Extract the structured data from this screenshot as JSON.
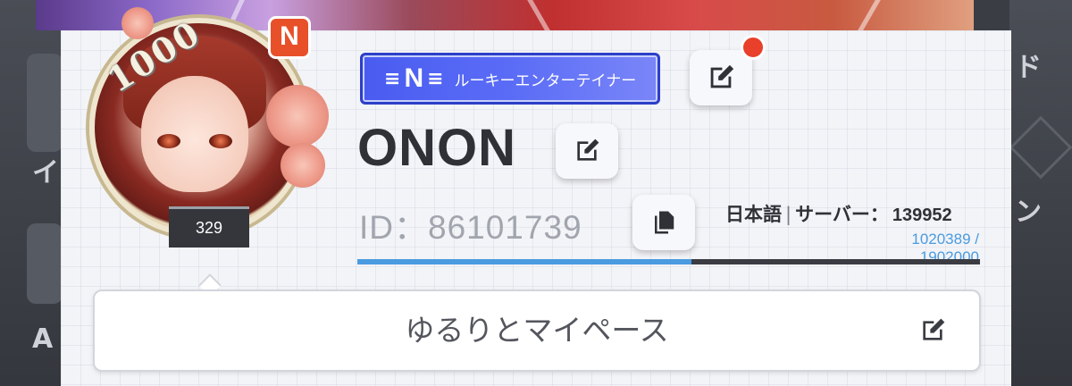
{
  "background": {
    "left_fragment_text": "イ",
    "left_fragment_text2": "A",
    "right_fragment_text": "ド",
    "right_fragment_text2": "ン"
  },
  "avatar": {
    "frame_number": "1000",
    "badge_letter": "N",
    "level": "329"
  },
  "title_badge": {
    "emblem_letter": "N",
    "label": "ルーキーエンターテイナー"
  },
  "player": {
    "name": "ONON",
    "id_label": "ID：86101739"
  },
  "info": {
    "language": "日本語",
    "separator": "|",
    "server_label": "サーバー：",
    "server_number": "139952"
  },
  "exp": {
    "current": 1020389,
    "max": 1902000,
    "text": "1020389 / 1902000"
  },
  "comment": {
    "text": "ゆるりとマイペース"
  },
  "icons": {
    "title_edit": "edit-icon",
    "name_edit": "edit-icon",
    "copy_id": "copy-icon",
    "comment_edit": "edit-icon"
  },
  "colors": {
    "title_blue": "#4a5cf0",
    "exp_blue": "#4a9be0",
    "notification_red": "#e8402a",
    "n_badge_orange": "#e8502a"
  }
}
